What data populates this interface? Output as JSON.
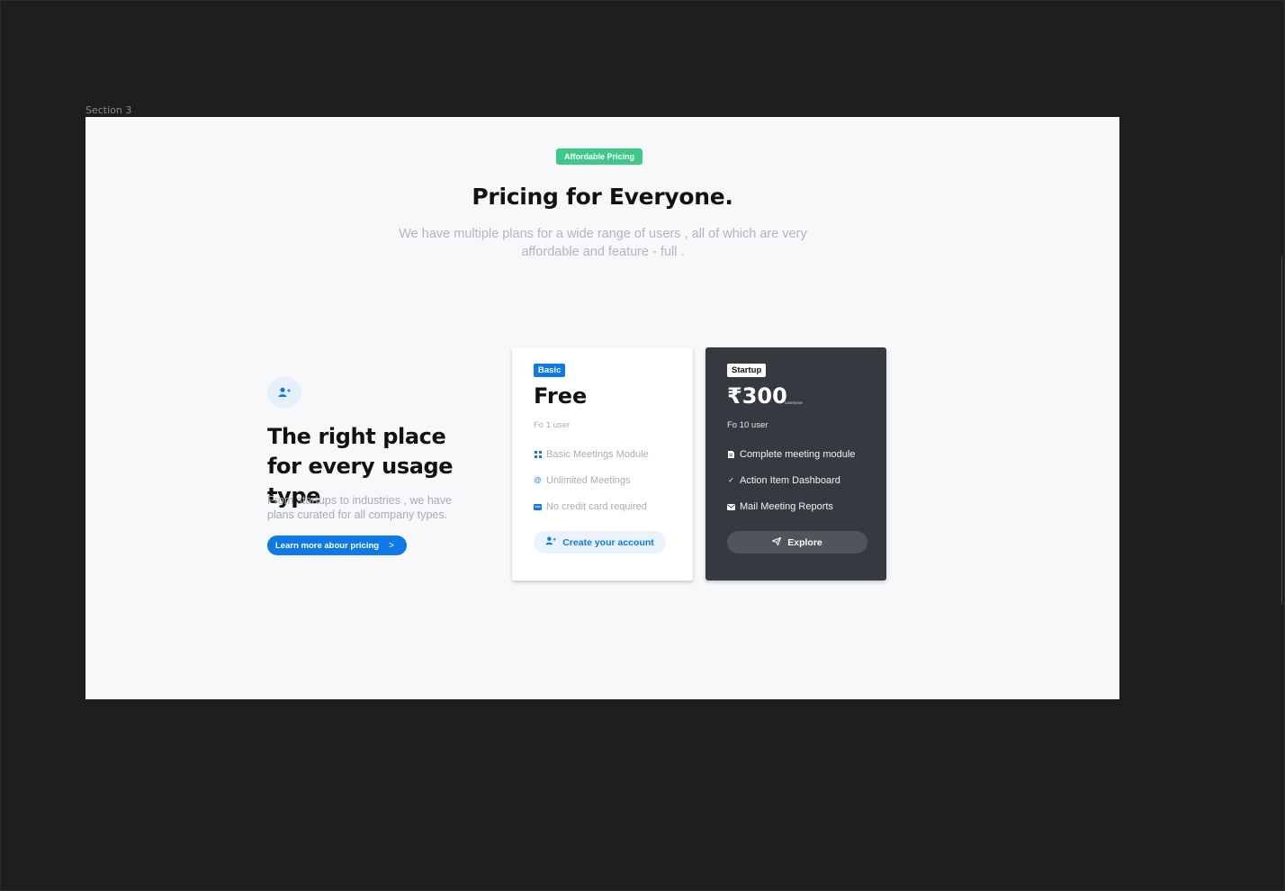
{
  "frame_label": "Section 3",
  "hero": {
    "badge": "Affordable Pricing",
    "title": "Pricing for Everyone.",
    "subtitle": "We have multiple plans for a wide range of users , all of which are very affordable and feature - full ."
  },
  "left": {
    "icon": "user-plus-icon",
    "heading": "The right place for every usage type",
    "description": "From startups to industries , we have plans curated for all company types.",
    "button_label": "Learn more abour pricing",
    "button_chevron": ">"
  },
  "plans": [
    {
      "tag": "Basic",
      "price": "Free",
      "users": "Fo 1 user",
      "features": [
        {
          "icon": "grid-icon",
          "label": "Basic Meetings Module"
        },
        {
          "icon": "at-sign-icon",
          "label": "Unlimited Meetings"
        },
        {
          "icon": "credit-card-icon",
          "label": "No credit card required"
        }
      ],
      "button_label": "Create your account",
      "button_icon": "user-plus-icon"
    },
    {
      "tag": "Startup",
      "price": "₹300",
      "per": "/user/year",
      "users": "Fo 10 user",
      "features": [
        {
          "icon": "document-icon",
          "label": "Complete meeting module"
        },
        {
          "icon": "check-icon",
          "label": "Action Item Dashboard"
        },
        {
          "icon": "mail-icon",
          "label": "Mail Meeting Reports"
        }
      ],
      "button_label": "Explore",
      "button_icon": "send-icon"
    }
  ],
  "colors": {
    "canvas": "#1e1e1e",
    "frame": "#f7f8fa",
    "accent_blue": "#0f7ae5",
    "accent_green": "#3ec98a",
    "dark_card": "#363a40"
  }
}
